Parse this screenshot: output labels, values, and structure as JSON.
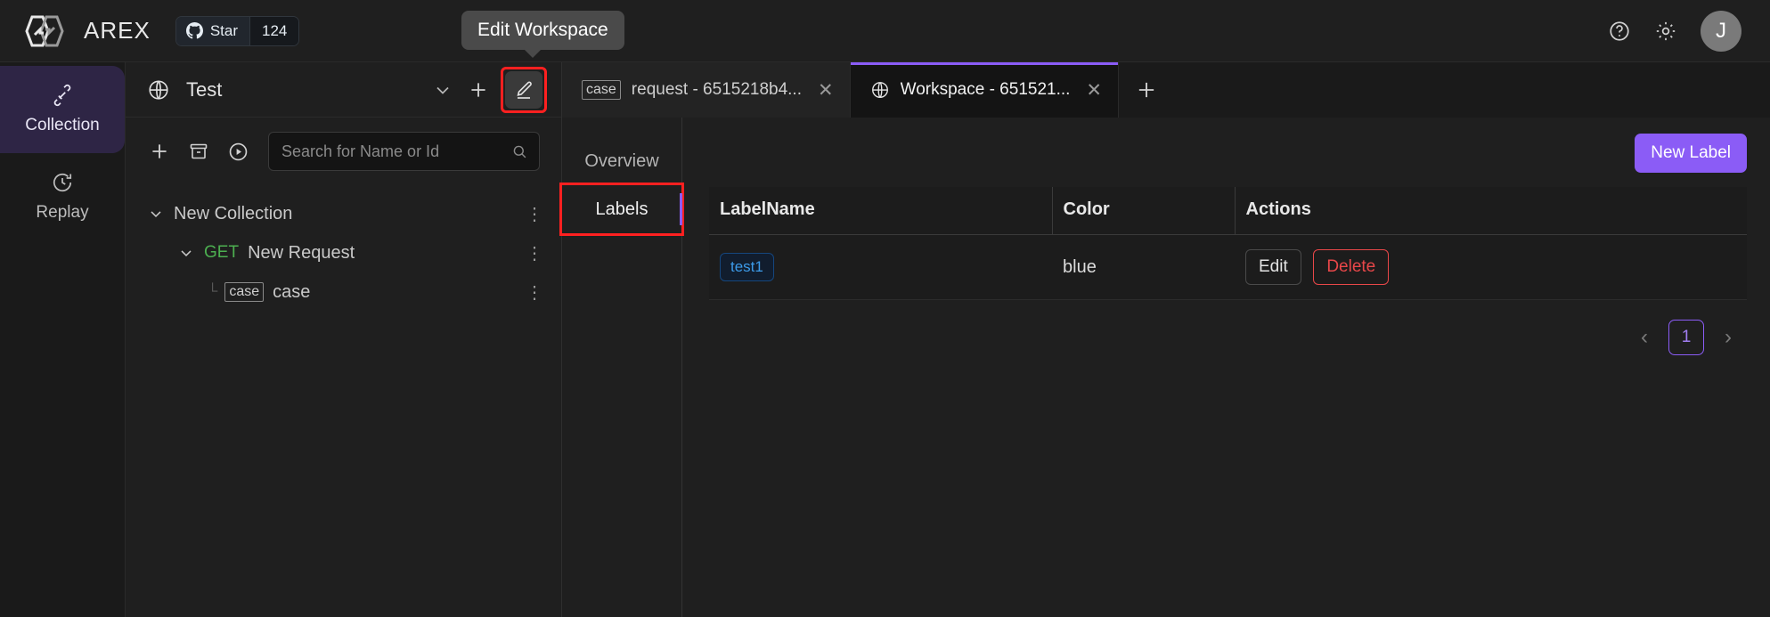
{
  "topbar": {
    "brand": "AREX",
    "github": {
      "star_label": "Star",
      "star_count": "124"
    },
    "help_icon": "question-circle-icon",
    "settings_icon": "gear-icon",
    "avatar_initial": "J"
  },
  "tooltip": {
    "text": "Edit Workspace"
  },
  "rail": {
    "items": [
      {
        "label": "Collection",
        "icon": "collection-icon",
        "active": true
      },
      {
        "label": "Replay",
        "icon": "history-clock-icon",
        "active": false
      }
    ]
  },
  "collection_panel": {
    "workspace_icon": "globe-icon",
    "workspace_name": "Test",
    "chevron_icon": "chevron-down-icon",
    "add_icon": "plus-icon",
    "edit_icon": "pencil-icon",
    "toolbar": {
      "add_icon": "plus-icon",
      "archive_icon": "archive-box-icon",
      "run_icon": "play-circle-icon"
    },
    "search": {
      "placeholder": "Search for Name or Id",
      "value": "",
      "icon": "search-icon"
    },
    "tree": [
      {
        "label": "New Collection",
        "level": 1,
        "expanded": true,
        "verb": "",
        "badge": ""
      },
      {
        "label": "New Request",
        "level": 2,
        "expanded": true,
        "verb": "GET",
        "badge": ""
      },
      {
        "label": "case",
        "level": 3,
        "expanded": false,
        "verb": "",
        "badge": "case"
      }
    ],
    "row_menu_icon": "more-vertical-icon"
  },
  "tabs": {
    "items": [
      {
        "label": "request - 6515218b4...",
        "badge": "case",
        "icon": "",
        "active": false
      },
      {
        "label": "Workspace - 651521...",
        "badge": "",
        "icon": "globe-icon",
        "active": true
      }
    ],
    "close_icon": "close-icon",
    "add_icon": "plus-icon"
  },
  "subnav": {
    "items": [
      {
        "label": "Overview",
        "active": false,
        "highlighted": false
      },
      {
        "label": "Labels",
        "active": true,
        "highlighted": true
      }
    ]
  },
  "labels_panel": {
    "new_label_button": "New Label",
    "table": {
      "headers": [
        "LabelName",
        "Color",
        "Actions"
      ],
      "rows": [
        {
          "name": "test1",
          "color": "blue",
          "edit": "Edit",
          "delete": "Delete"
        }
      ]
    },
    "pagination": {
      "prev_icon": "chevron-left-icon",
      "current": "1",
      "next_icon": "chevron-right-icon"
    }
  },
  "colors": {
    "accent_purple": "#8b5cf6",
    "danger_red": "#e84749",
    "tag_blue": "#3c9ae8",
    "verb_get_green": "#4caf50",
    "highlight_box_red": "#ff2020"
  }
}
